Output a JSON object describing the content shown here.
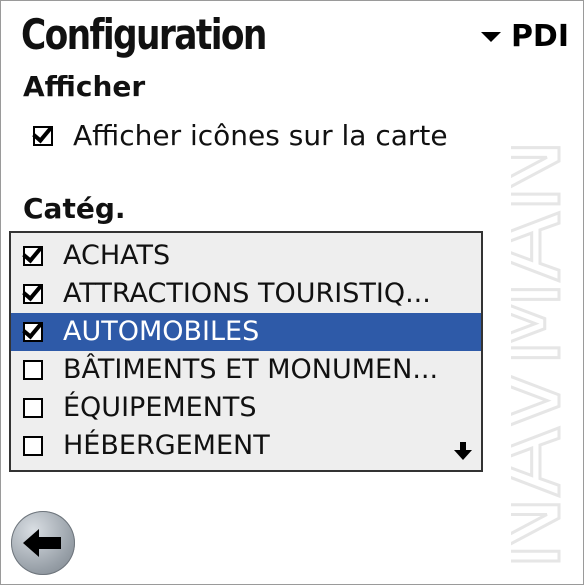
{
  "header": {
    "title": "Configuration",
    "category_label": "PDI"
  },
  "display": {
    "section_label": "Afficher",
    "show_icons": {
      "label": "Afficher icônes sur la carte",
      "checked": true
    }
  },
  "categories": {
    "section_label": "Catég.",
    "selected_index": 2,
    "items": [
      {
        "label": "ACHATS",
        "checked": true
      },
      {
        "label": "ATTRACTIONS TOURISTIQ...",
        "checked": true
      },
      {
        "label": "AUTOMOBILES",
        "checked": true
      },
      {
        "label": "BÂTIMENTS ET MONUMEN...",
        "checked": false
      },
      {
        "label": "ÉQUIPEMENTS",
        "checked": false
      },
      {
        "label": "HÉBERGEMENT",
        "checked": false
      }
    ]
  },
  "watermark": {
    "text": "NAVMAN"
  },
  "icons": {
    "back": "back-arrow-icon",
    "scroll": "scroll-down-arrow-icon",
    "dropdown": "dropdown-triangle-icon"
  },
  "colors": {
    "selection": "#2e5aa8",
    "list_background": "#eeeeee"
  }
}
